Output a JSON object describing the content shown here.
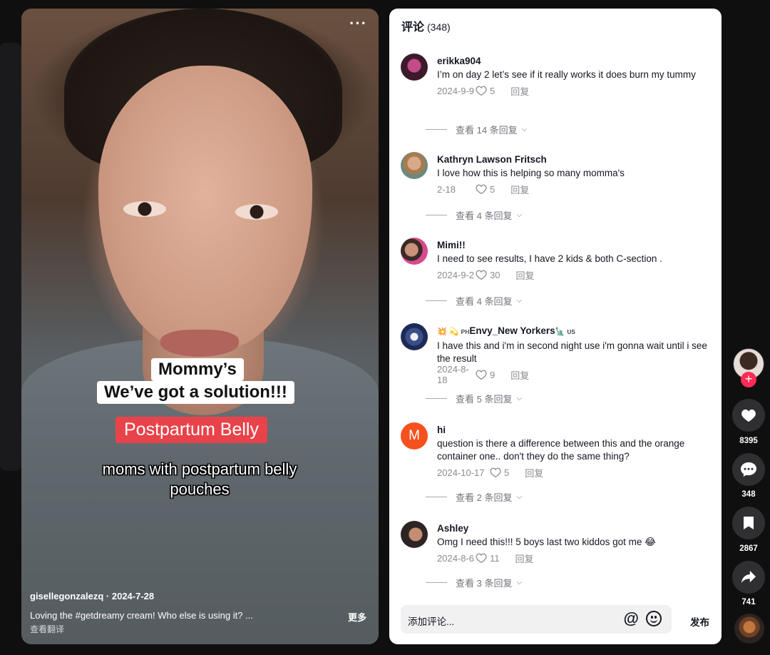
{
  "video": {
    "captions": {
      "line1": "Mommy’s",
      "line2": "We’ve got a solution!!!",
      "highlight": "Postpartum Belly",
      "subtitle1": "moms with postpartum belly",
      "subtitle2": "pouches"
    },
    "author_line": "gisellegonzalezq · 2024-7-28",
    "description": "Loving the #getdreamy  cream! Who else is using it? ...",
    "translate_label": "查看翻译",
    "more_label": "更多"
  },
  "comments_panel": {
    "title": "评论",
    "count": "(348)",
    "comments": [
      {
        "user": "erikka904",
        "text": "I’m on day 2 let’s see if it really works it does burn my tummy",
        "date": "2024-9-9",
        "likes": "5",
        "reply_label": "回复",
        "view_replies": "查看 14 条回复"
      },
      {
        "user": "Kathryn Lawson Fritsch",
        "text": "I love how this is helping so many momma's",
        "date": "2-18",
        "likes": "5",
        "reply_label": "回复",
        "view_replies": "查看 4 条回复"
      },
      {
        "user": "Mimi!!",
        "text": "I need to see results, I have 2 kids & both C-section .",
        "date": "2024-9-2",
        "likes": "30",
        "reply_label": "回复",
        "view_replies": "查看 4 条回复"
      },
      {
        "user_prefix": "💥 💫 ᴘʜ",
        "user": "Envy_New Yorkers",
        "user_suffix": "🗽 ᴜs",
        "text": "I have this and i'm in second night use i'm gonna wait until i see the result",
        "date": "2024-8-18",
        "likes": "9",
        "reply_label": "回复",
        "view_replies": "查看 5 条回复"
      },
      {
        "user": "hi",
        "avatar_letter": "M",
        "text": "question is there a difference between this and the orange container one.. don't they do the same thing?",
        "date": "2024-10-17",
        "likes": "5",
        "reply_label": "回复",
        "view_replies": "查看 2 条回复"
      },
      {
        "user": "Ashley",
        "text": "Omg I need this!!! 5 boys last two kiddos got me 😂",
        "date": "2024-8-6",
        "likes": "11",
        "reply_label": "回复",
        "view_replies": "查看 3 条回复"
      }
    ],
    "input_placeholder": "添加评论...",
    "at_symbol": "@",
    "post_label": "发布"
  },
  "rail": {
    "follow_symbol": "+",
    "likes": "8395",
    "comments": "348",
    "saves": "2867",
    "shares": "741"
  },
  "colors": {
    "accent_pink": "#fe2c55",
    "caption_red": "#e8434a",
    "avatar_m": "#f4511e"
  }
}
